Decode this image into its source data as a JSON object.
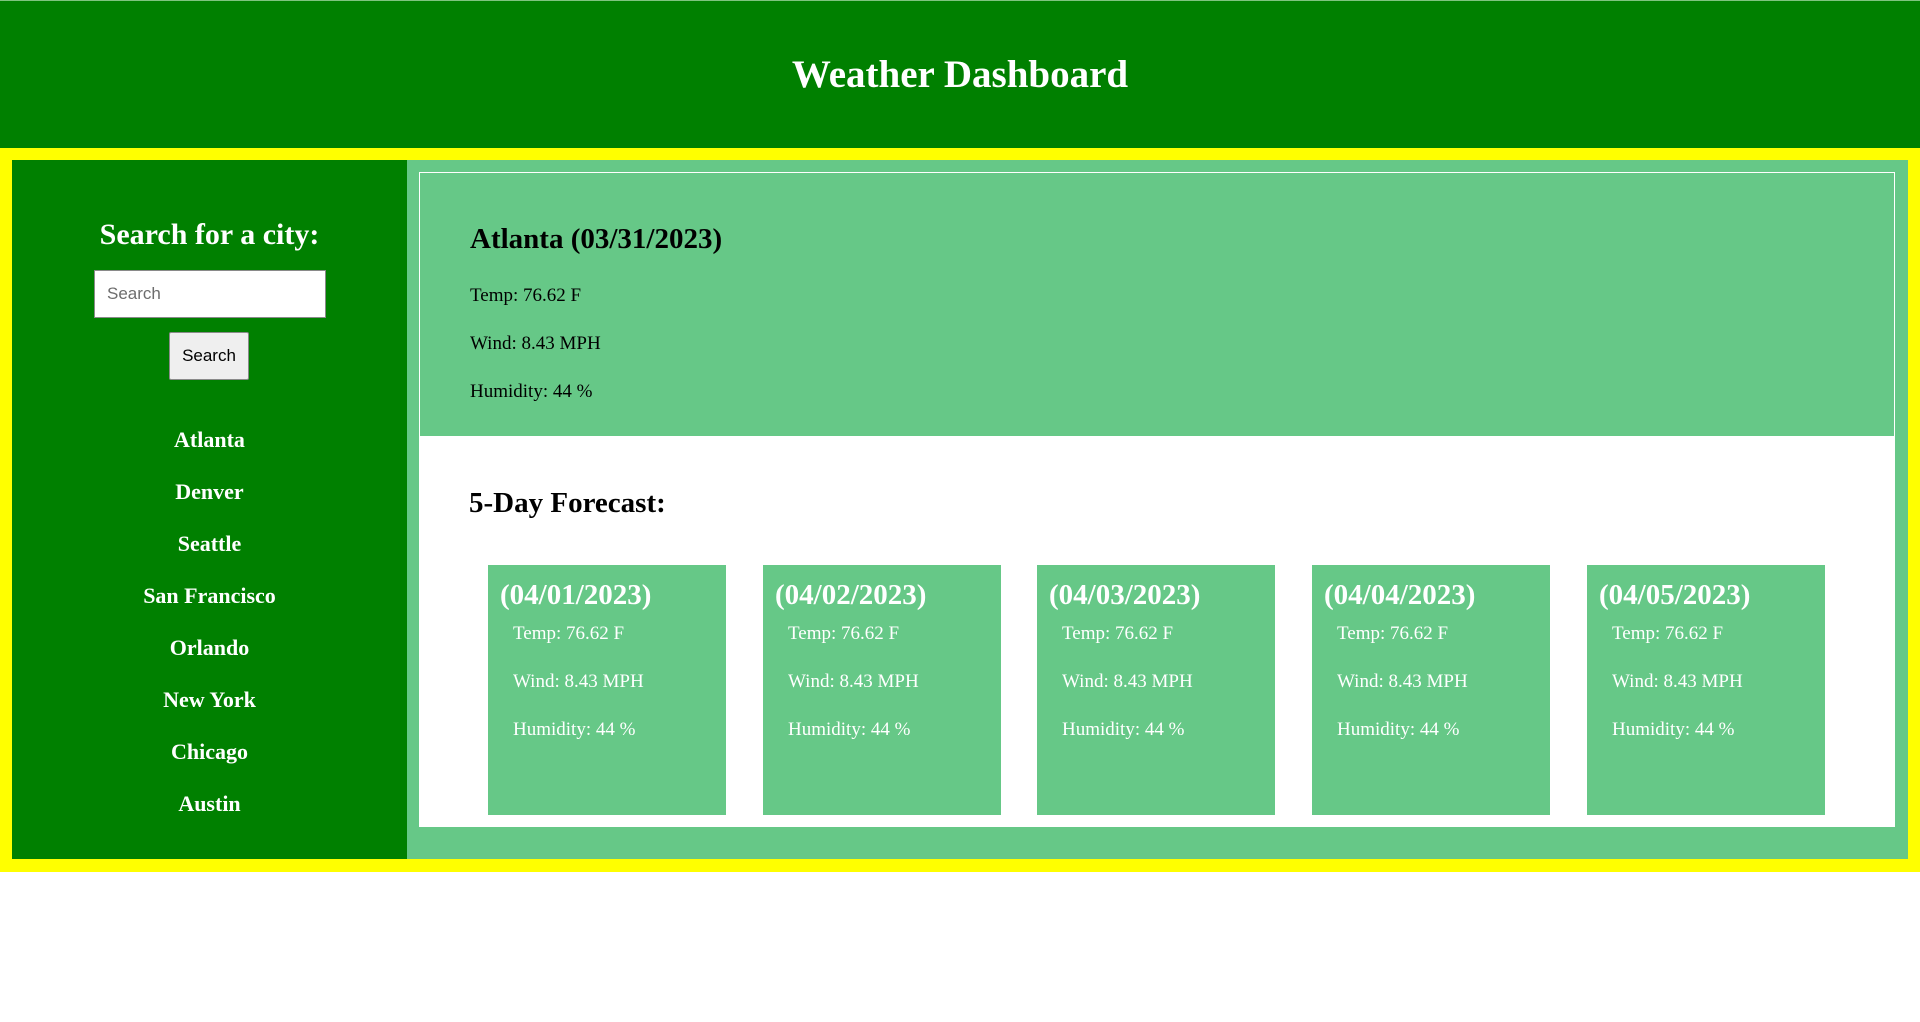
{
  "header": {
    "title": "Weather Dashboard"
  },
  "sidebar": {
    "heading": "Search for a city:",
    "search_placeholder": "Search",
    "search_button": "Search",
    "cities": [
      "Atlanta",
      "Denver",
      "Seattle",
      "San Francisco",
      "Orlando",
      "New York",
      "Chicago",
      "Austin"
    ]
  },
  "current": {
    "title": "Atlanta (03/31/2023)",
    "temp": "Temp: 76.62 F",
    "wind": "Wind: 8.43 MPH",
    "humidity": "Humidity: 44 %"
  },
  "forecast": {
    "heading": "5-Day Forecast:",
    "days": [
      {
        "date": "(04/01/2023)",
        "temp": "Temp: 76.62 F",
        "wind": "Wind: 8.43 MPH",
        "humidity": "Humidity: 44 %"
      },
      {
        "date": "(04/02/2023)",
        "temp": "Temp: 76.62 F",
        "wind": "Wind: 8.43 MPH",
        "humidity": "Humidity: 44 %"
      },
      {
        "date": "(04/03/2023)",
        "temp": "Temp: 76.62 F",
        "wind": "Wind: 8.43 MPH",
        "humidity": "Humidity: 44 %"
      },
      {
        "date": "(04/04/2023)",
        "temp": "Temp: 76.62 F",
        "wind": "Wind: 8.43 MPH",
        "humidity": "Humidity: 44 %"
      },
      {
        "date": "(04/05/2023)",
        "temp": "Temp: 76.62 F",
        "wind": "Wind: 8.43 MPH",
        "humidity": "Humidity: 44 %"
      }
    ]
  },
  "colors": {
    "header_bg": "#008000",
    "frame_border": "#ffff00",
    "sidebar_bg": "#008000",
    "panel_bg": "#66c887",
    "forecast_bg": "#ffffff"
  }
}
